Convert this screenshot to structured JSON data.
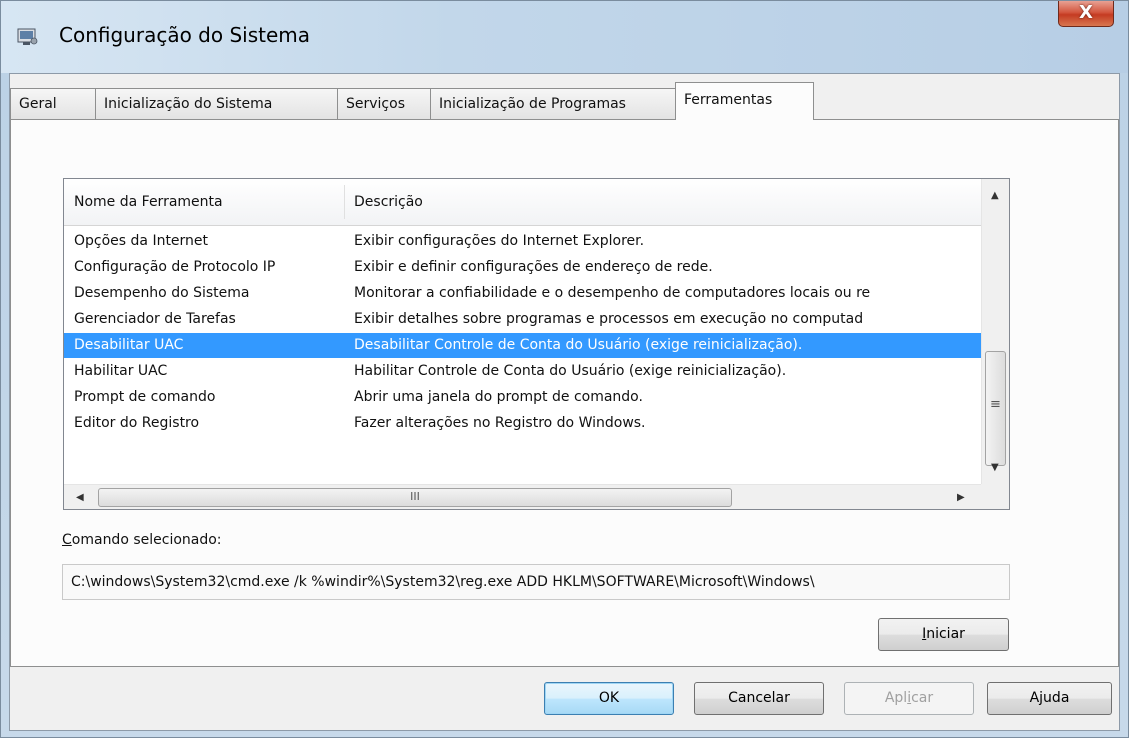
{
  "window": {
    "title": "Configuração do Sistema",
    "close_glyph": "X"
  },
  "tabs": [
    {
      "label": "Geral"
    },
    {
      "label": "Inicialização do Sistema"
    },
    {
      "label": "Serviços"
    },
    {
      "label": "Inicialização de Programas"
    },
    {
      "label": "Ferramentas"
    }
  ],
  "active_tab": "Ferramentas",
  "listview": {
    "columns": [
      "Nome da Ferramenta",
      "Descrição"
    ],
    "rows": [
      {
        "name": "Opções da Internet",
        "desc": "Exibir configurações do Internet Explorer."
      },
      {
        "name": "Configuração de Protocolo IP",
        "desc": "Exibir e definir configurações de endereço de rede."
      },
      {
        "name": "Desempenho do Sistema",
        "desc": "Monitorar a confiabilidade e o desempenho de computadores locais ou re"
      },
      {
        "name": "Gerenciador de Tarefas",
        "desc": "Exibir detalhes sobre programas e processos em execução no computad"
      },
      {
        "name": "Desabilitar UAC",
        "desc": "Desabilitar Controle de Conta do Usuário (exige reinicialização)."
      },
      {
        "name": "Habilitar UAC",
        "desc": "Habilitar Controle de Conta do Usuário (exige reinicialização)."
      },
      {
        "name": "Prompt de comando",
        "desc": "Abrir uma janela do prompt de comando."
      },
      {
        "name": "Editor do Registro",
        "desc": "Fazer alterações no Registro do Windows."
      }
    ],
    "selected_row": "Desabilitar UAC",
    "hscroll_thumb_glyph": "III",
    "vscroll_mid_glyph": "≡"
  },
  "command": {
    "label_first": "C",
    "label_rest": "omando selecionado:",
    "value": "C:\\windows\\System32\\cmd.exe /k %windir%\\System32\\reg.exe ADD HKLM\\SOFTWARE\\Microsoft\\Windows\\"
  },
  "buttons": {
    "iniciar_first": "I",
    "iniciar_rest": "niciar",
    "ok": "OK",
    "cancelar": "Cancelar",
    "aplicar_pre": "Apl",
    "aplicar_u": "i",
    "aplicar_post": "car",
    "ajuda": "Ajuda"
  },
  "colors": {
    "selection": "#3399ff",
    "close_button": "#c43b22"
  }
}
